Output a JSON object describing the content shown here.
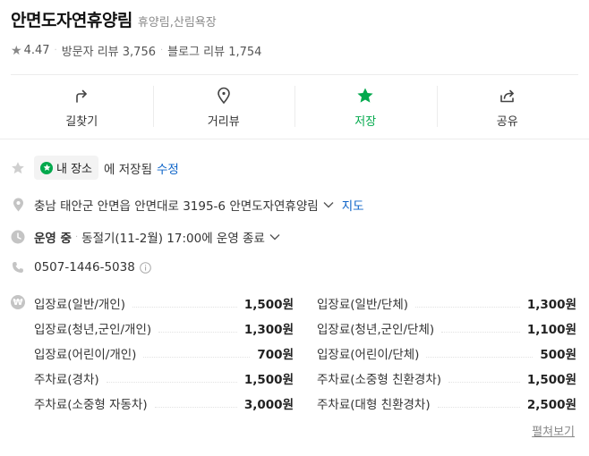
{
  "place": {
    "name": "안면도자연휴양림",
    "category": "휴양림,산림욕장",
    "rating": "4.47",
    "visitor_reviews": "방문자 리뷰 3,756",
    "blog_reviews": "블로그 리뷰 1,754"
  },
  "actions": [
    {
      "label": "길찾기",
      "icon": "directions-icon"
    },
    {
      "label": "거리뷰",
      "icon": "street-view-icon"
    },
    {
      "label": "저장",
      "icon": "star-icon",
      "active": true
    },
    {
      "label": "공유",
      "icon": "share-icon"
    }
  ],
  "saved": {
    "badge": "내 장소",
    "text": "에 저장됨",
    "edit": "수정"
  },
  "address": {
    "text": "충남 태안군 안면읍 안면대로 3195-6 안면도자연휴양림",
    "map_link": "지도"
  },
  "hours": {
    "status": "운영 중",
    "detail": "동절기(11-2월) 17:00에 운영 종료"
  },
  "phone": "0507-1446-5038",
  "fees": [
    [
      {
        "name": "입장료(일반/개인)",
        "price": "1,500원"
      },
      {
        "name": "입장료(일반/단체)",
        "price": "1,300원"
      }
    ],
    [
      {
        "name": "입장료(청년,군인/개인)",
        "price": "1,300원"
      },
      {
        "name": "입장료(청년,군인/단체)",
        "price": "1,100원"
      }
    ],
    [
      {
        "name": "입장료(어린이/개인)",
        "price": "700원"
      },
      {
        "name": "입장료(어린이/단체)",
        "price": "500원"
      }
    ],
    [
      {
        "name": "주차료(경차)",
        "price": "1,500원"
      },
      {
        "name": "주차료(소중형 친환경차)",
        "price": "1,500원"
      }
    ],
    [
      {
        "name": "주차료(소중형 자동차)",
        "price": "3,000원"
      },
      {
        "name": "주차료(대형 친환경차)",
        "price": "2,500원"
      }
    ]
  ],
  "expand_label": "펼쳐보기",
  "colors": {
    "accent": "#03a94d",
    "link": "#0e64c8"
  }
}
